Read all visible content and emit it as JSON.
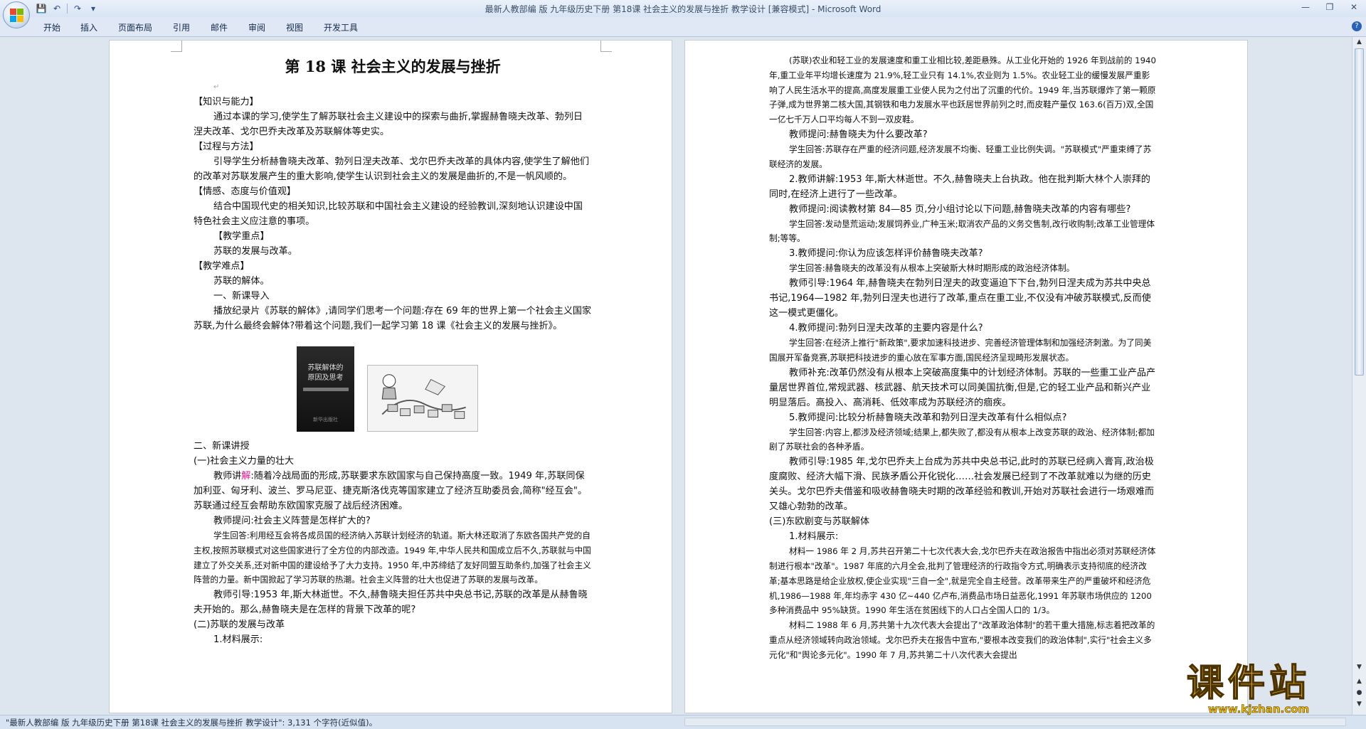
{
  "window": {
    "title": "最新人教部编 版 九年级历史下册  第18课   社会主义的发展与挫折 教学设计 [兼容模式] - Microsoft Word"
  },
  "ribbon": {
    "tabs": [
      "开始",
      "插入",
      "页面布局",
      "引用",
      "邮件",
      "审阅",
      "视图",
      "开发工具"
    ]
  },
  "status": {
    "text": "\"最新人教部编 版 九年级历史下册  第18课   社会主义的发展与挫折 教学设计\": 3,131 个字符(近似值)。"
  },
  "watermark": {
    "brand": "课件站",
    "url": "www.kjzhan.com"
  },
  "left_page": {
    "title": "第 18 课   社会主义的发展与挫折",
    "h_knowledge": "【知识与能力】",
    "p_knowledge": "通过本课的学习,使学生了解苏联社会主义建设中的探索与曲折,掌握赫鲁晓夫改革、勃列日涅夫改革、戈尔巴乔夫改革及苏联解体等史实。",
    "h_process": "【过程与方法】",
    "p_process": "引导学生分析赫鲁晓夫改革、勃列日涅夫改革、戈尔巴乔夫改革的具体内容,使学生了解他们的改革对苏联发展产生的重大影响,使学生认识到社会主义的发展是曲折的,不是一帆风顺的。",
    "h_emotion": "【情感、态度与价值观】",
    "p_emotion": "结合中国现代史的相关知识,比较苏联和中国社会主义建设的经验教训,深刻地认识建设中国特色社会主义应注意的事项。",
    "h_key": "【教学重点】",
    "p_key": "苏联的发展与改革。",
    "h_difficult": "【教学难点】",
    "p_difficult": "苏联的解体。",
    "intro": "一、新课导入",
    "intro_text": "播放纪录片《苏联的解体》,请同学们思考一个问题:存在 69 年的世界上第一个社会主义国家苏联,为什么最终会解体?带着这个问题,我们一起学习第 18 课《社会主义的发展与挫折》。",
    "book_title_1": "苏联解体的",
    "book_title_2": "原因及思考",
    "book_footer": "新华出版社",
    "section2": "二、新课讲授",
    "sub1": "(一)社会主义力量的壮大",
    "teacher1_a": "教师讲",
    "teacher1_b": "解",
    "teacher1_c": ":随着冷战局面的形成,苏联要求东欧国家与自己保持高度一致。1949 年,苏联同保加利亚、匈牙利、波兰、罗马尼亚、捷克斯洛伐克等国家建立了经济互助委员会,简称\"经互会\"。苏联通过经互会帮助东欧国家克服了战后经济困难。",
    "teacher_q1": "教师提问:社会主义阵营是怎样扩大的?",
    "student_a1": "学生回答:利用经互会将各成员国的经济纳入苏联计划经济的轨道。斯大林还取消了东欧各国共产党的自主权,按照苏联模式对这些国家进行了全方位的内部改造。1949 年,中华人民共和国成立后不久,苏联就与中国建立了外交关系,还对新中国的建设给予了大力支持。1950 年,中苏缔结了友好同盟互助条约,加强了社会主义阵营的力量。新中国掀起了学习苏联的热潮。社会主义阵营的壮大也促进了苏联的发展与改革。",
    "teacher_guide1": "教师引导:1953 年,斯大林逝世。不久,赫鲁晓夫担任苏共中央总书记,苏联的改革是从赫鲁晓夫开始的。那么,赫鲁晓夫是在怎样的背景下改革的呢?",
    "sub2": "(二)苏联的发展与改革",
    "material1": "1.材料展示:"
  },
  "right_page": {
    "p_material": "(苏联)农业和轻工业的发展速度和重工业相比较,差距悬殊。从工业化开始的 1926 年到战前的 1940 年,重工业年平均增长速度为 21.9%,轻工业只有 14.1%,农业则为 1.5%。农业轻工业的缓慢发展严重影响了人民生活水平的提高,高度发展重工业使人民为之付出了沉重的代价。1949 年,当苏联爆炸了第一颗原子弹,成为世界第二核大国,其钢铁和电力发展水平也跃居世界前列之时,而皮鞋产量仅 163.6(百万)双,全国一亿七千万人口平均每人不到一双皮鞋。",
    "q1": "教师提问:赫鲁晓夫为什么要改革?",
    "a1": "学生回答:苏联存在严重的经济问题,经济发展不均衡、轻重工业比例失调。\"苏联模式\"严重束缚了苏联经济的发展。",
    "item2": "2.教师讲解:1953 年,斯大林逝世。不久,赫鲁晓夫上台执政。他在批判斯大林个人崇拜的同时,在经济上进行了一些改革。",
    "q2": "教师提问:阅读教材第 84—85 页,分小组讨论以下问题,赫鲁晓夫改革的内容有哪些?",
    "a2": "学生回答:发动垦荒运动;发展饲养业,广种玉米;取消农产品的义务交售制,改行收购制;改革工业管理体制;等等。",
    "item3": "3.教师提问:你认为应该怎样评价赫鲁晓夫改革?",
    "a3": "学生回答:赫鲁晓夫的改革没有从根本上突破斯大林时期形成的政治经济体制。",
    "guide2": "教师引导:1964 年,赫鲁晓夫在勃列日涅夫的政变逼迫下下台,勃列日涅夫成为苏共中央总书记,1964—1982 年,勃列日涅夫也进行了改革,重点在重工业,不仅没有冲破苏联模式,反而使这一模式更僵化。",
    "item4": "4.教师提问:勃列日涅夫改革的主要内容是什么?",
    "a4": "学生回答:在经济上推行\"新政策\",要求加速科技进步、完善经济管理体制和加强经济刺激。为了同美国展开军备竞赛,苏联把科技进步的重心放在军事方面,国民经济呈现畸形发展状态。",
    "supp": "教师补充:改革仍然没有从根本上突破高度集中的计划经济体制。苏联的一些重工业产品产量居世界首位,常规武器、核武器、航天技术可以同美国抗衡,但是,它的轻工业产品和新兴产业明显落后。高投入、高消耗、低效率成为苏联经济的痼疾。",
    "item5": "5.教师提问:比较分析赫鲁晓夫改革和勃列日涅夫改革有什么相似点?",
    "a5": "学生回答:内容上,都涉及经济领域;结果上,都失败了,都没有从根本上改变苏联的政治、经济体制;都加剧了苏联社会的各种矛盾。",
    "guide3": "教师引导:1985 年,戈尔巴乔夫上台成为苏共中央总书记,此时的苏联已经病入膏肓,政治极度腐败、经济大幅下滑、民族矛盾公开化锐化……社会发展已经到了不改革就难以为继的历史关头。戈尔巴乔夫借鉴和吸收赫鲁晓夫时期的改革经验和教训,开始对苏联社会进行一场艰难而又雄心勃勃的改革。",
    "sub3": "(三)东欧剧变与苏联解体",
    "mat_head": "1.材料展示:",
    "mat1": "材料一  1986 年 2 月,苏共召开第二十七次代表大会,戈尔巴乔夫在政治报告中指出必须对苏联经济体制进行根本\"改革\"。1987 年底的六月全会,批判了管理经济的行政指令方式,明确表示支持彻底的经济改革;基本思路是给企业放权,使企业实现\"三自一全\",就是完全自主经营。改革带来生产的严重破坏和经济危机,1986—1988 年,年均赤字 430 亿~440 亿卢布,消费品市场日益恶化,1991 年苏联市场供应的 1200 多种消费品中 95%缺货。1990 年生活在贫困线下的人口占全国人口的 1/3。",
    "mat2": "材料二  1988 年 6 月,苏共第十九次代表大会提出了\"改革政治体制\"的若干重大措施,标志着把改革的重点从经济领域转向政治领域。戈尔巴乔夫在报告中宣布,\"要根本改变我们的政治体制\",实行\"社会主义多元化\"和\"舆论多元化\"。1990 年 7 月,苏共第二十八次代表大会提出"
  }
}
